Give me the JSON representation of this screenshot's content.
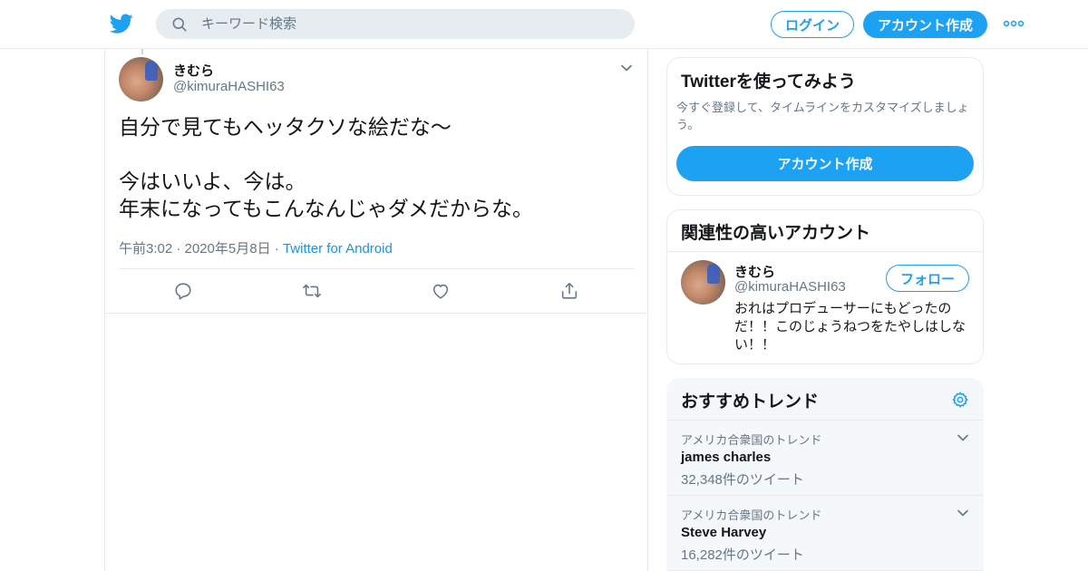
{
  "header": {
    "search_placeholder": "キーワード検索",
    "login_label": "ログイン",
    "signup_label": "アカウント作成"
  },
  "tweet": {
    "author_name": "きむら",
    "author_handle": "@kimuraHASHI63",
    "text": "自分で見てもヘッタクソな絵だな～\n\n今はいいよ、今は。\n年末になってもこんなんじゃダメだからな。",
    "time": "午前3:02 · 2020年5月8日",
    "separator": " · ",
    "source": "Twitter for Android",
    "actions": [
      "reply-icon",
      "retweet-icon",
      "like-icon",
      "share-icon"
    ]
  },
  "sidebar": {
    "signup_card": {
      "title": "Twitterを使ってみよう",
      "description": "今すぐ登録して、タイムラインをカスタマイズしましょう。",
      "button_label": "アカウント作成"
    },
    "related": {
      "title": "関連性の高いアカウント",
      "name": "きむら",
      "handle": "@kimuraHASHI63",
      "follow_label": "フォロー",
      "bio": "おれはプロデューサーにもどったのだ！！このじょうねつをたやしはしない！！"
    },
    "trends": {
      "title": "おすすめトレンド",
      "items": [
        {
          "context": "アメリカ合衆国のトレンド",
          "name": "james charles",
          "count": "32,348件のツイート"
        },
        {
          "context": "アメリカ合衆国のトレンド",
          "name": "Steve Harvey",
          "count": "16,282件のツイート"
        }
      ]
    }
  },
  "colors": {
    "accent": "#1da1f2",
    "link": "#1b95e0",
    "secondary_text": "#657786",
    "border": "#e6ecf0",
    "trends_bg": "#f5f8fa"
  }
}
